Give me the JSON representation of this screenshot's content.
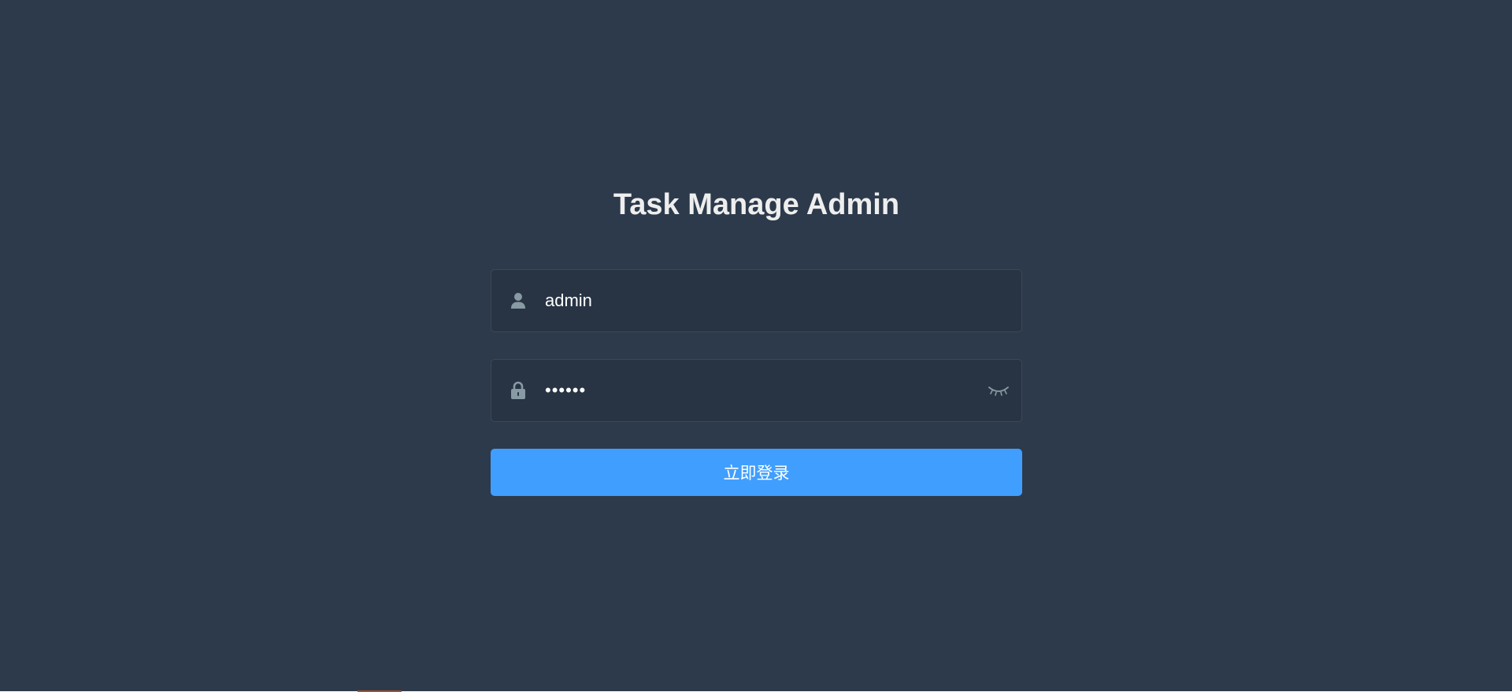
{
  "login": {
    "title": "Task Manage Admin",
    "username": {
      "value": "admin",
      "icon": "user-icon"
    },
    "password": {
      "masked_value": "••••••",
      "icon": "lock-icon",
      "toggle_icon": "eye-closed-icon"
    },
    "submit_label": "立即登录"
  },
  "colors": {
    "background": "#2d3a4b",
    "input_background": "#283443",
    "button": "#409eff",
    "title_text": "#eeeeee",
    "icon": "#889aa4"
  }
}
